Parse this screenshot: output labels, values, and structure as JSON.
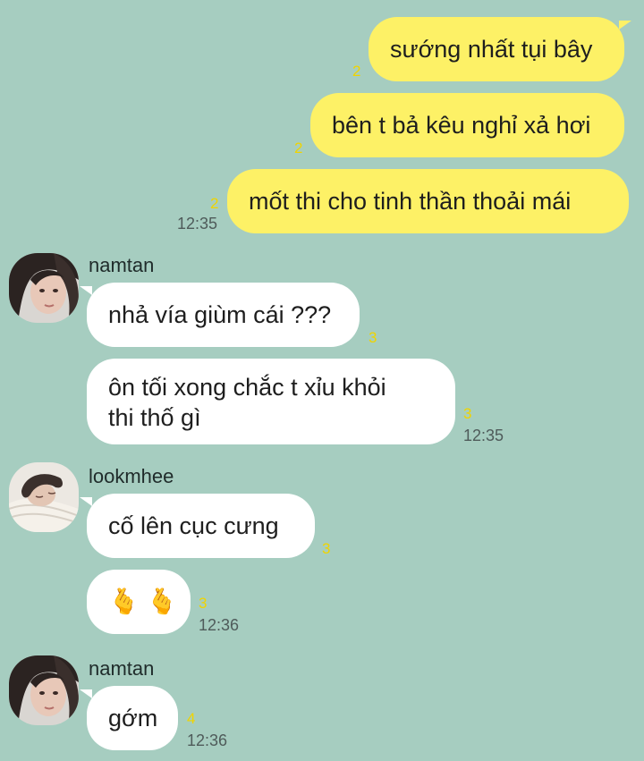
{
  "colors": {
    "background": "#a6cdc0",
    "outgoing_bubble": "#fdf166",
    "incoming_bubble": "#ffffff",
    "read_count": "#f0d400",
    "timestamp": "#4f5b5a"
  },
  "outgoing": [
    {
      "text": "sướng nhất tụi bây",
      "read": "2"
    },
    {
      "text": "bên t bả kêu nghỉ xả hơi",
      "read": "2"
    },
    {
      "text": "mốt thi cho tinh thần thoải mái",
      "read": "2",
      "time": "12:35"
    }
  ],
  "groups": [
    {
      "sender": "namtan",
      "avatar_icon": "profile-photo-icon",
      "messages": [
        {
          "text": "nhả vía giùm cái ???",
          "read": "3"
        },
        {
          "text": [
            "ôn tối xong chắc t xỉu khỏi",
            "thi thố gì"
          ],
          "read": "3",
          "time": "12:35"
        }
      ]
    },
    {
      "sender": "lookmhee",
      "avatar_icon": "profile-photo-icon",
      "messages": [
        {
          "text": "cố lên cục cưng",
          "read": "3"
        },
        {
          "emoji": [
            "🫰",
            "🫰"
          ],
          "emoji_icon": "finger-heart-icon",
          "read": "3",
          "time": "12:36"
        }
      ]
    },
    {
      "sender": "namtan",
      "avatar_icon": "profile-photo-icon",
      "messages": [
        {
          "text": "gớm",
          "read": "4",
          "time": "12:36"
        }
      ]
    }
  ]
}
